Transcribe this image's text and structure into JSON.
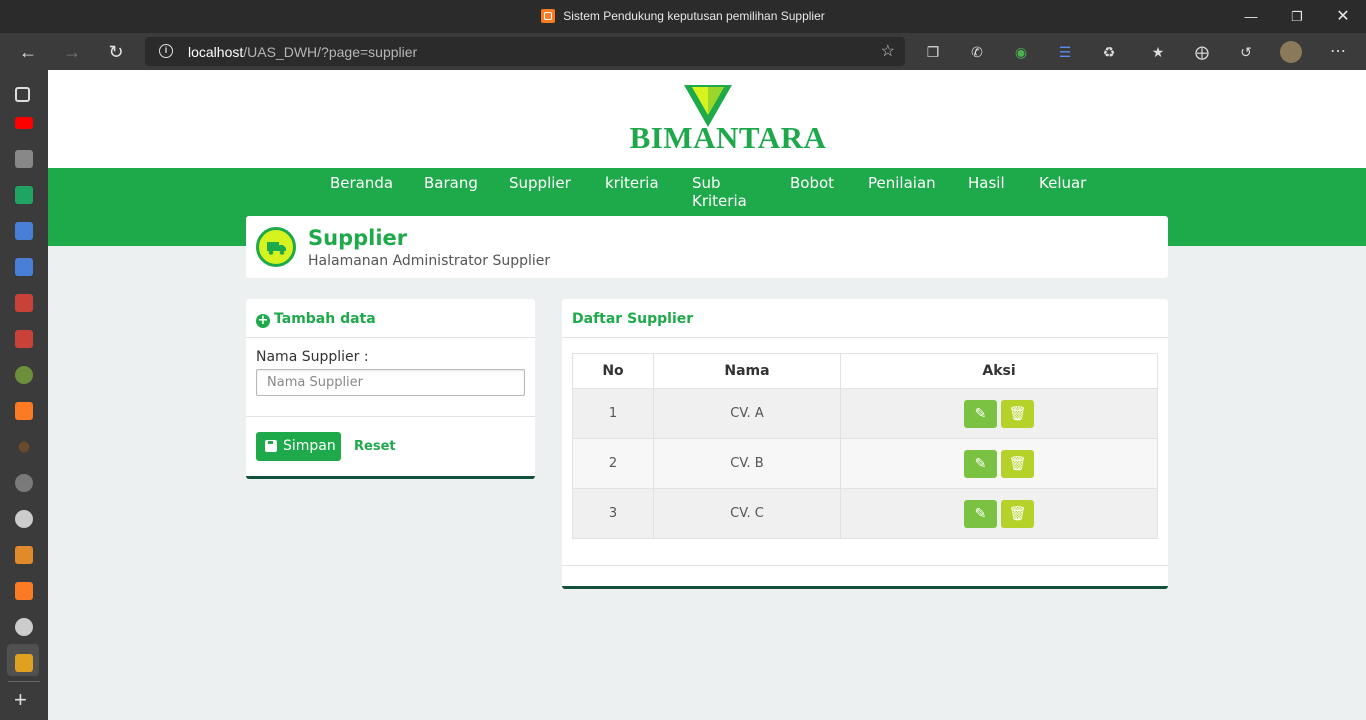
{
  "browser": {
    "tab_title": "Sistem Pendukung keputusan pemilihan Supplier",
    "url_host": "localhost",
    "url_path": "/UAS_DWH/?page=supplier"
  },
  "brand": {
    "name": "BIMANTARA",
    "color": "#1eaa4b",
    "accent": "#d6f21f"
  },
  "nav": {
    "items": [
      "Beranda",
      "Barang",
      "Supplier",
      "kriteria",
      "Sub Kriteria",
      "Bobot",
      "Penilaian",
      "Hasil",
      "Keluar"
    ]
  },
  "hero": {
    "title": "Supplier",
    "subtitle": "Halamanan Administrator Supplier",
    "icon": "truck-icon"
  },
  "form": {
    "title": "Tambah data",
    "field_label": "Nama Supplier :",
    "field_placeholder": "Nama Supplier",
    "field_value": "",
    "save_label": "Simpan",
    "reset_label": "Reset"
  },
  "list": {
    "title": "Daftar Supplier",
    "columns": [
      "No",
      "Nama",
      "Aksi"
    ],
    "rows": [
      {
        "no": "1",
        "nama": "CV. A"
      },
      {
        "no": "2",
        "nama": "CV. B"
      },
      {
        "no": "3",
        "nama": "CV. C"
      }
    ]
  }
}
